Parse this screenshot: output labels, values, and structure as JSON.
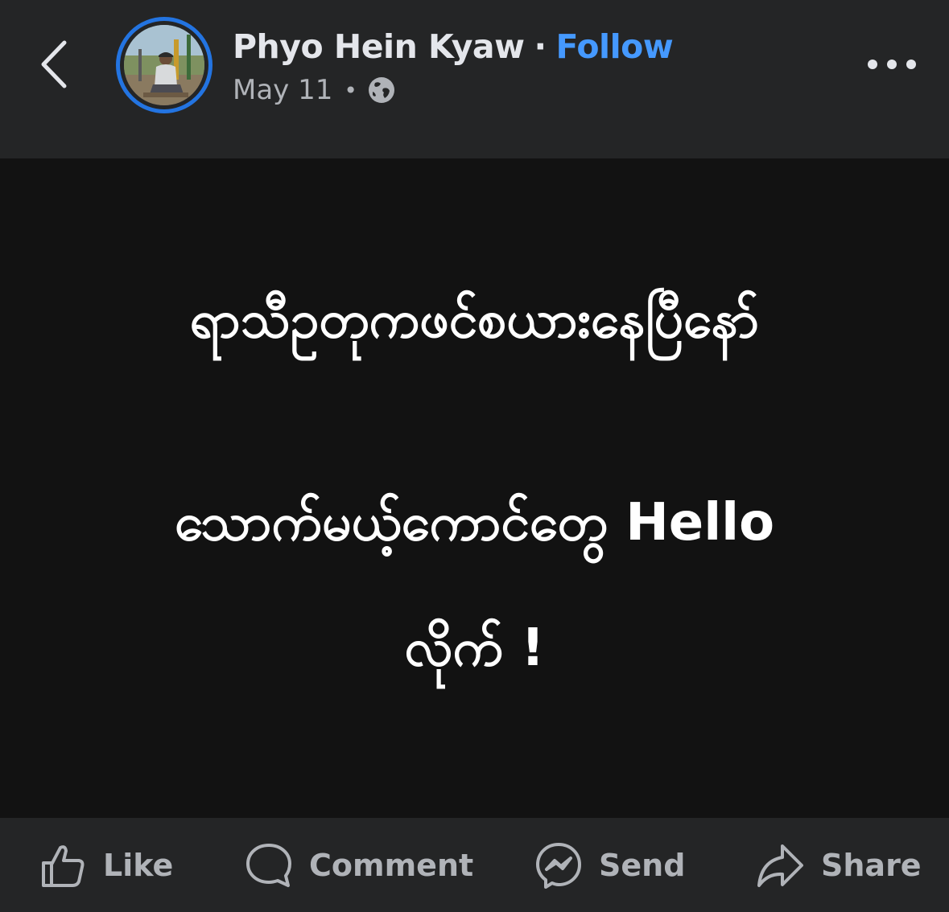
{
  "header": {
    "author_name": "Phyo Hein Kyaw",
    "separator": "·",
    "follow_label": "Follow",
    "date": "May 11",
    "meta_separator": "•",
    "audience_icon": "globe-icon",
    "back_icon": "chevron-left-icon",
    "more_icon": "more-dots-icon"
  },
  "post": {
    "line1": "ရာသီဥတုကဖင်စယားနေပြီနော်",
    "line2": "သောက်မယ့်ကောင်တွေ Hello",
    "line3": "လိုက် !",
    "background_color": "#121212",
    "text_color": "#ffffff"
  },
  "actions": {
    "like": {
      "label": "Like",
      "icon": "thumbs-up-icon"
    },
    "comment": {
      "label": "Comment",
      "icon": "comment-icon"
    },
    "send": {
      "label": "Send",
      "icon": "messenger-icon"
    },
    "share": {
      "label": "Share",
      "icon": "share-arrow-icon"
    }
  },
  "colors": {
    "surface": "#242526",
    "accent": "#4599ff",
    "avatar_ring": "#2374e1",
    "secondary_text": "#b0b3b8"
  }
}
